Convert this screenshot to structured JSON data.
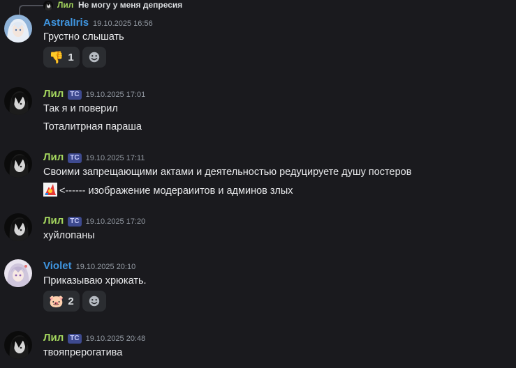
{
  "reply": {
    "author": "Лил",
    "text": "Не могу у меня депресия"
  },
  "colors": {
    "lil": "#a4d65e",
    "astral": "#3f95e0",
    "violet": "#3f95e0",
    "tag_bg": "#3e4a8f"
  },
  "messages": [
    {
      "author": "AstralIris",
      "time": "19.10.2025 16:56",
      "lines": [
        "Грустно слышать"
      ],
      "reactions": [
        {
          "emoji": "thumbs-down",
          "count": "1"
        }
      ]
    },
    {
      "author": "Лил",
      "tag": "ТС",
      "time": "19.10.2025 17:01",
      "lines": [
        "Так я и поверил",
        "Тоталитрная параша"
      ]
    },
    {
      "author": "Лил",
      "tag": "ТС",
      "time": "19.10.2025 17:11",
      "lines": [
        "Своими запрещающими актами и деятельностью редуцируете душу постеров",
        "<------ изображение модераиитов и админов злых"
      ]
    },
    {
      "author": "Лил",
      "tag": "ТС",
      "time": "19.10.2025 17:20",
      "lines": [
        "хуйлопаны"
      ]
    },
    {
      "author": "Violet",
      "time": "19.10.2025 20:10",
      "lines": [
        "Приказываю хрюкать."
      ],
      "reactions": [
        {
          "emoji": "pig-face",
          "count": "2"
        }
      ]
    },
    {
      "author": "Лил",
      "tag": "ТС",
      "time": "19.10.2025 20:48",
      "lines": [
        "твояпрерогатива"
      ]
    }
  ],
  "icons": {
    "add_reaction": "smile-plus-icon",
    "inline": "clown-emoji-icon"
  }
}
